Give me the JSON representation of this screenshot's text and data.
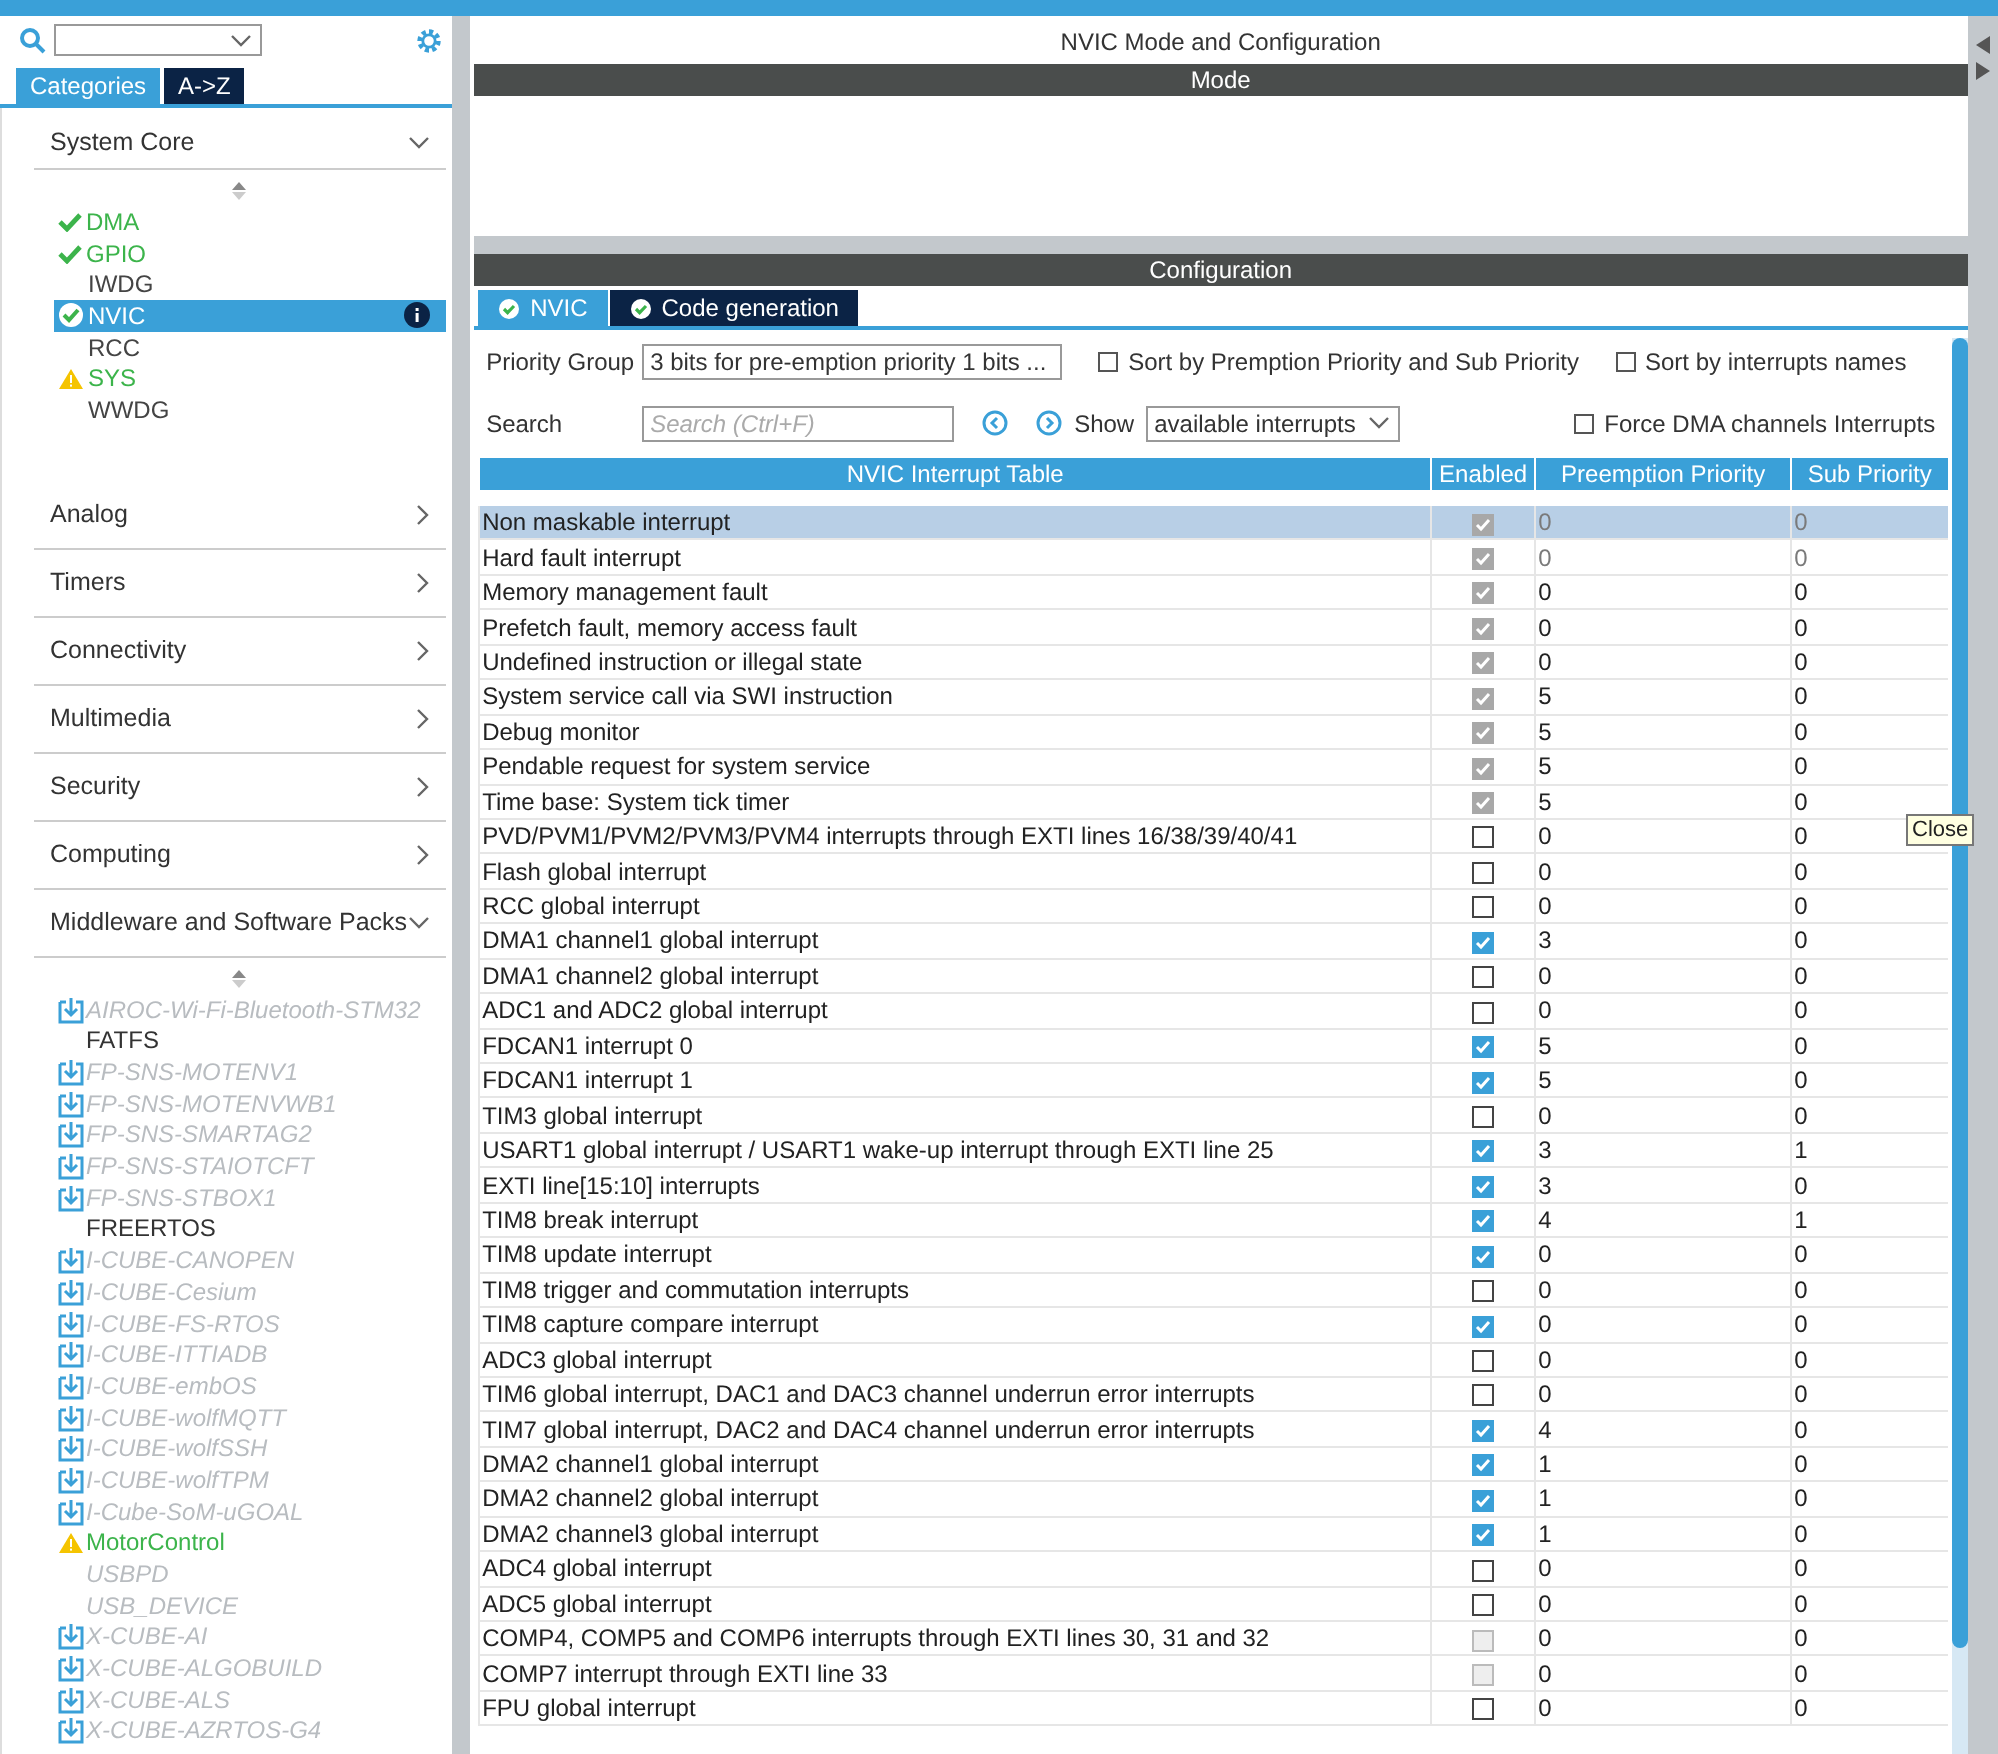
{
  "sidebar": {
    "tabs": [
      {
        "label": "Categories",
        "selected": true
      },
      {
        "label": "A->Z",
        "selected": false
      }
    ],
    "system_core": {
      "title": "System Core",
      "expanded": true,
      "items": [
        {
          "label": "DMA",
          "kind": "ok",
          "selected": false
        },
        {
          "label": "GPIO",
          "kind": "ok",
          "selected": false
        },
        {
          "label": "IWDG",
          "kind": "none",
          "selected": false
        },
        {
          "label": "NVIC",
          "kind": "ok",
          "selected": true
        },
        {
          "label": "RCC",
          "kind": "none",
          "selected": false
        },
        {
          "label": "SYS",
          "kind": "warning",
          "selected": false
        },
        {
          "label": "WWDG",
          "kind": "none",
          "selected": false
        }
      ]
    },
    "categories": [
      {
        "label": "Analog",
        "expanded": false
      },
      {
        "label": "Timers",
        "expanded": false
      },
      {
        "label": "Connectivity",
        "expanded": false
      },
      {
        "label": "Multimedia",
        "expanded": false
      },
      {
        "label": "Security",
        "expanded": false
      },
      {
        "label": "Computing",
        "expanded": false
      },
      {
        "label": "Middleware and Software Packs",
        "expanded": true
      }
    ],
    "packs": [
      {
        "label": "AIROC-Wi-Fi-Bluetooth-STM32",
        "kind": "download"
      },
      {
        "label": "FATFS",
        "kind": "installed"
      },
      {
        "label": "FP-SNS-MOTENV1",
        "kind": "download"
      },
      {
        "label": "FP-SNS-MOTENVWB1",
        "kind": "download"
      },
      {
        "label": "FP-SNS-SMARTAG2",
        "kind": "download"
      },
      {
        "label": "FP-SNS-STAIOTCFT",
        "kind": "download"
      },
      {
        "label": "FP-SNS-STBOX1",
        "kind": "download"
      },
      {
        "label": "FREERTOS",
        "kind": "installed"
      },
      {
        "label": "I-CUBE-CANOPEN",
        "kind": "download"
      },
      {
        "label": "I-CUBE-Cesium",
        "kind": "download"
      },
      {
        "label": "I-CUBE-FS-RTOS",
        "kind": "download"
      },
      {
        "label": "I-CUBE-ITTIADB",
        "kind": "download"
      },
      {
        "label": "I-CUBE-embOS",
        "kind": "download"
      },
      {
        "label": "I-CUBE-wolfMQTT",
        "kind": "download"
      },
      {
        "label": "I-CUBE-wolfSSH",
        "kind": "download"
      },
      {
        "label": "I-CUBE-wolfTPM",
        "kind": "download"
      },
      {
        "label": "I-Cube-SoM-uGOAL",
        "kind": "download"
      },
      {
        "label": "MotorControl",
        "kind": "warning"
      },
      {
        "label": "USBPD",
        "kind": "unavailable"
      },
      {
        "label": "USB_DEVICE",
        "kind": "unavailable"
      },
      {
        "label": "X-CUBE-AI",
        "kind": "download"
      },
      {
        "label": "X-CUBE-ALGOBUILD",
        "kind": "download"
      },
      {
        "label": "X-CUBE-ALS",
        "kind": "download"
      },
      {
        "label": "X-CUBE-AZRTOS-G4",
        "kind": "download"
      }
    ]
  },
  "main": {
    "title": "NVIC Mode and Configuration",
    "mode_header": "Mode",
    "config_header": "Configuration",
    "tabs": [
      {
        "label": "NVIC",
        "selected": true
      },
      {
        "label": "Code generation",
        "selected": false
      }
    ],
    "priority_group": {
      "label": "Priority Group",
      "value": "3 bits for pre-emption priority 1 bits ..."
    },
    "sort_options": [
      {
        "label": "Sort by Premption Priority and Sub Priority",
        "checked": false
      },
      {
        "label": "Sort by interrupts names",
        "checked": false
      }
    ],
    "search": {
      "label": "Search",
      "placeholder": "Search (Ctrl+F)"
    },
    "show": {
      "label": "Show",
      "value": "available interrupts"
    },
    "force_dma": {
      "label": "Force DMA channels Interrupts",
      "checked": false
    },
    "table": {
      "columns": [
        "NVIC Interrupt Table",
        "Enabled",
        "Preemption Priority",
        "Sub Priority"
      ],
      "rows": [
        {
          "name": "Non maskable interrupt",
          "enabled": true,
          "disabled": true,
          "values_disabled": true,
          "preemption": "0",
          "sub": "0",
          "selected": true
        },
        {
          "name": "Hard fault interrupt",
          "enabled": true,
          "disabled": true,
          "values_disabled": true,
          "preemption": "0",
          "sub": "0",
          "selected": false
        },
        {
          "name": "Memory management fault",
          "enabled": true,
          "disabled": true,
          "values_disabled": false,
          "preemption": "0",
          "sub": "0",
          "selected": false
        },
        {
          "name": "Prefetch fault, memory access fault",
          "enabled": true,
          "disabled": true,
          "values_disabled": false,
          "preemption": "0",
          "sub": "0",
          "selected": false
        },
        {
          "name": "Undefined instruction or illegal state",
          "enabled": true,
          "disabled": true,
          "values_disabled": false,
          "preemption": "0",
          "sub": "0",
          "selected": false
        },
        {
          "name": "System service call via SWI instruction",
          "enabled": true,
          "disabled": true,
          "values_disabled": false,
          "preemption": "5",
          "sub": "0",
          "selected": false
        },
        {
          "name": "Debug monitor",
          "enabled": true,
          "disabled": true,
          "values_disabled": false,
          "preemption": "5",
          "sub": "0",
          "selected": false
        },
        {
          "name": "Pendable request for system service",
          "enabled": true,
          "disabled": true,
          "values_disabled": false,
          "preemption": "5",
          "sub": "0",
          "selected": false
        },
        {
          "name": "Time base: System tick timer",
          "enabled": true,
          "disabled": true,
          "values_disabled": false,
          "preemption": "5",
          "sub": "0",
          "selected": false
        },
        {
          "name": "PVD/PVM1/PVM2/PVM3/PVM4 interrupts through EXTI lines 16/38/39/40/41",
          "enabled": false,
          "disabled": false,
          "values_disabled": false,
          "preemption": "0",
          "sub": "0",
          "selected": false
        },
        {
          "name": "Flash global interrupt",
          "enabled": false,
          "disabled": false,
          "values_disabled": false,
          "preemption": "0",
          "sub": "0",
          "selected": false
        },
        {
          "name": "RCC global interrupt",
          "enabled": false,
          "disabled": false,
          "values_disabled": false,
          "preemption": "0",
          "sub": "0",
          "selected": false
        },
        {
          "name": "DMA1 channel1 global interrupt",
          "enabled": true,
          "disabled": false,
          "values_disabled": false,
          "preemption": "3",
          "sub": "0",
          "selected": false
        },
        {
          "name": "DMA1 channel2 global interrupt",
          "enabled": false,
          "disabled": false,
          "values_disabled": false,
          "preemption": "0",
          "sub": "0",
          "selected": false
        },
        {
          "name": "ADC1 and ADC2 global interrupt",
          "enabled": false,
          "disabled": false,
          "values_disabled": false,
          "preemption": "0",
          "sub": "0",
          "selected": false
        },
        {
          "name": "FDCAN1 interrupt 0",
          "enabled": true,
          "disabled": false,
          "values_disabled": false,
          "preemption": "5",
          "sub": "0",
          "selected": false
        },
        {
          "name": "FDCAN1 interrupt 1",
          "enabled": true,
          "disabled": false,
          "values_disabled": false,
          "preemption": "5",
          "sub": "0",
          "selected": false
        },
        {
          "name": "TIM3 global interrupt",
          "enabled": false,
          "disabled": false,
          "values_disabled": false,
          "preemption": "0",
          "sub": "0",
          "selected": false
        },
        {
          "name": "USART1 global interrupt / USART1 wake-up interrupt through EXTI line 25",
          "enabled": true,
          "disabled": false,
          "values_disabled": false,
          "preemption": "3",
          "sub": "1",
          "selected": false
        },
        {
          "name": "EXTI line[15:10] interrupts",
          "enabled": true,
          "disabled": false,
          "values_disabled": false,
          "preemption": "3",
          "sub": "0",
          "selected": false
        },
        {
          "name": "TIM8 break interrupt",
          "enabled": true,
          "disabled": false,
          "values_disabled": false,
          "preemption": "4",
          "sub": "1",
          "selected": false
        },
        {
          "name": "TIM8 update interrupt",
          "enabled": true,
          "disabled": false,
          "values_disabled": false,
          "preemption": "0",
          "sub": "0",
          "selected": false
        },
        {
          "name": "TIM8 trigger and commutation interrupts",
          "enabled": false,
          "disabled": false,
          "values_disabled": false,
          "preemption": "0",
          "sub": "0",
          "selected": false
        },
        {
          "name": "TIM8 capture compare interrupt",
          "enabled": true,
          "disabled": false,
          "values_disabled": false,
          "preemption": "0",
          "sub": "0",
          "selected": false
        },
        {
          "name": "ADC3 global interrupt",
          "enabled": false,
          "disabled": false,
          "values_disabled": false,
          "preemption": "0",
          "sub": "0",
          "selected": false
        },
        {
          "name": "TIM6 global interrupt, DAC1 and DAC3 channel underrun error interrupts",
          "enabled": false,
          "disabled": false,
          "values_disabled": false,
          "preemption": "0",
          "sub": "0",
          "selected": false
        },
        {
          "name": "TIM7 global interrupt, DAC2 and DAC4 channel underrun error interrupts",
          "enabled": true,
          "disabled": false,
          "values_disabled": false,
          "preemption": "4",
          "sub": "0",
          "selected": false
        },
        {
          "name": "DMA2 channel1 global interrupt",
          "enabled": true,
          "disabled": false,
          "values_disabled": false,
          "preemption": "1",
          "sub": "0",
          "selected": false
        },
        {
          "name": "DMA2 channel2 global interrupt",
          "enabled": true,
          "disabled": false,
          "values_disabled": false,
          "preemption": "1",
          "sub": "0",
          "selected": false
        },
        {
          "name": "DMA2 channel3 global interrupt",
          "enabled": true,
          "disabled": false,
          "values_disabled": false,
          "preemption": "1",
          "sub": "0",
          "selected": false
        },
        {
          "name": "ADC4 global interrupt",
          "enabled": false,
          "disabled": false,
          "values_disabled": false,
          "preemption": "0",
          "sub": "0",
          "selected": false
        },
        {
          "name": "ADC5 global interrupt",
          "enabled": false,
          "disabled": false,
          "values_disabled": false,
          "preemption": "0",
          "sub": "0",
          "selected": false
        },
        {
          "name": "COMP4, COMP5 and COMP6 interrupts through EXTI lines 30, 31 and 32",
          "enabled": false,
          "disabled": true,
          "values_disabled": false,
          "preemption": "0",
          "sub": "0",
          "selected": false
        },
        {
          "name": "COMP7 interrupt through EXTI line 33",
          "enabled": false,
          "disabled": true,
          "values_disabled": false,
          "preemption": "0",
          "sub": "0",
          "selected": false
        },
        {
          "name": "FPU global interrupt",
          "enabled": false,
          "disabled": false,
          "values_disabled": false,
          "preemption": "0",
          "sub": "0",
          "selected": false
        }
      ]
    }
  },
  "tooltip": "Close"
}
